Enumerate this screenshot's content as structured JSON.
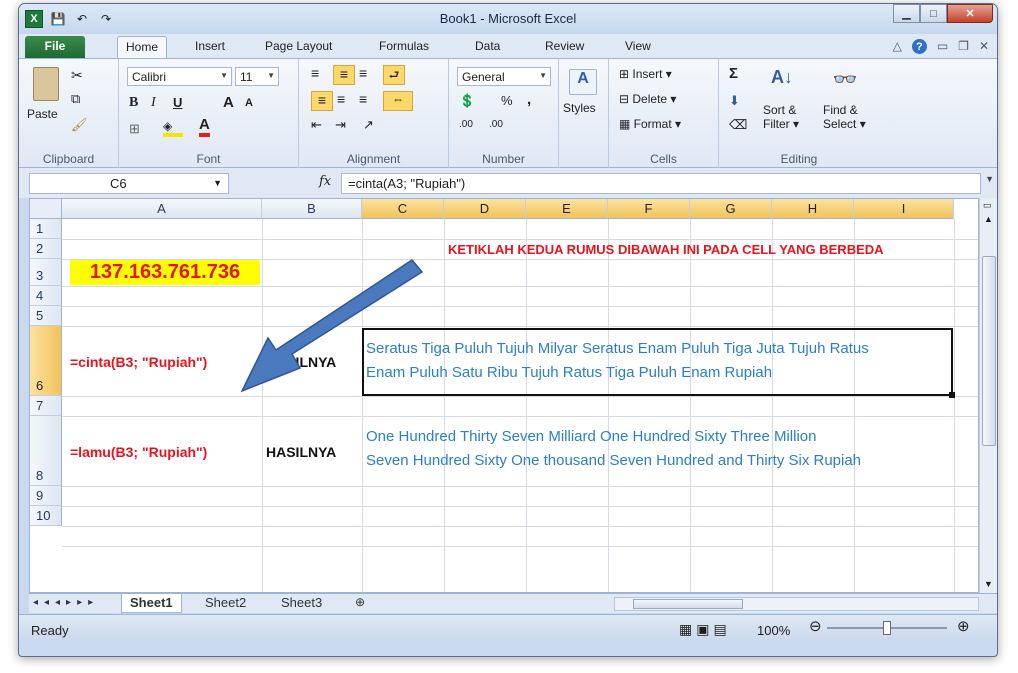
{
  "window": {
    "title": "Book1 - Microsoft Excel"
  },
  "qat": {
    "save": "💾",
    "undo": "↶",
    "redo": "↷"
  },
  "tabs": [
    "File",
    "Home",
    "Insert",
    "Page Layout",
    "Formulas",
    "Data",
    "Review",
    "View"
  ],
  "ribbon": {
    "clipboard": {
      "paste": "Paste",
      "label": "Clipboard"
    },
    "font": {
      "name": "Calibri",
      "size": "11",
      "bold": "B",
      "italic": "I",
      "underline": "U",
      "grow": "A",
      "shrink": "A",
      "color_letter": "A",
      "label": "Font"
    },
    "alignment": {
      "label": "Alignment"
    },
    "number": {
      "format": "General",
      "percent": "%",
      "comma": ",",
      "inc_dec": ".00",
      "label": "Number"
    },
    "styles": {
      "label": "Styles"
    },
    "cells": {
      "insert": "Insert",
      "delete": "Delete",
      "format": "Format",
      "label": "Cells"
    },
    "editing": {
      "sigma": "Σ",
      "sort": "Sort &",
      "filter": "Filter",
      "find": "Find &",
      "select": "Select",
      "label": "Editing"
    }
  },
  "formula_bar": {
    "name_box": "C6",
    "fx": "fx",
    "formula": "=cinta(A3; \"Rupiah\")"
  },
  "columns": [
    "A",
    "B",
    "C",
    "D",
    "E",
    "F",
    "G",
    "H",
    "I"
  ],
  "rows": [
    "1",
    "2",
    "3",
    "4",
    "5",
    "6",
    "7",
    "8",
    "9",
    "10"
  ],
  "cells": {
    "i2": "KETIKLAH KEDUA RUMUS DIBAWAH INI PADA CELL YANG BERBEDA",
    "a3": "137.163.761.736",
    "a6": "=cinta(B3; \"Rupiah\")",
    "b6": "HASILNYA",
    "c6_line1": "Seratus Tiga Puluh Tujuh Milyar Seratus Enam Puluh Tiga Juta Tujuh Ratus",
    "c6_line2": "Enam Puluh Satu Ribu Tujuh Ratus Tiga Puluh Enam Rupiah",
    "a8": "=lamu(B3; \"Rupiah\")",
    "b8": "HASILNYA",
    "c8_line1": "One Hundred Thirty Seven Milliard One Hundred Sixty Three Million",
    "c8_line2": "Seven Hundred Sixty One thousand Seven Hundred and Thirty Six Rupiah"
  },
  "sheet_tabs": [
    "Sheet1",
    "Sheet2",
    "Sheet3"
  ],
  "status": {
    "ready": "Ready",
    "zoom": "100%"
  },
  "colors": {
    "red": "#e8141c",
    "yellow": "#ffff00",
    "blue": "#2b7fc6",
    "arrow": "#4a79bd"
  }
}
